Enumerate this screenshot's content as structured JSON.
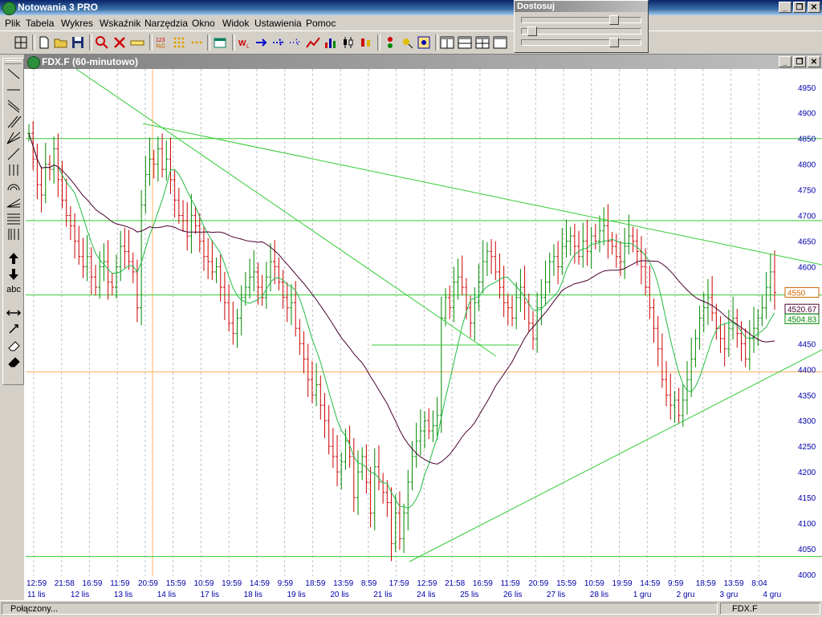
{
  "app": {
    "title": "Notowania 3 PRO"
  },
  "menu": [
    "Plik",
    "Tabela",
    "Wykres",
    "Wskaźnik",
    "Narzędzia",
    "Okno",
    "Widok",
    "Ustawienia",
    "Pomoc"
  ],
  "adjust_panel": {
    "title": "Dostosuj",
    "sliders": [
      0.8,
      0.05,
      0.8
    ]
  },
  "left_tools": {
    "text_tool": "abc"
  },
  "chart_window": {
    "title": "FDX.F (60-minutowo)"
  },
  "status": {
    "connection": "Połączony...",
    "symbol": "FDX.F"
  },
  "colors": {
    "accent_green": "#33cc33",
    "ma_dark": "#4a0030",
    "bar_red": "#cc0000",
    "bar_green": "#008800",
    "axis_text": "#0000aa",
    "grid": "#c0c0c0",
    "orange": "#ffb060"
  },
  "icons": [
    "crosshair-icon",
    "new-file-icon",
    "open-folder-icon",
    "save-icon",
    "zoom-icon",
    "delete-icon",
    "ruler-icon",
    "fib-icon",
    "grid-icon",
    "window-icon",
    "wl-icon",
    "arrows-icon",
    "line-chart-icon",
    "bar-chart-icon",
    "candles-icon",
    "traffic-light-icon",
    "pin-icon",
    "image-icon",
    "layout-icon"
  ],
  "chart_data": {
    "type": "bar",
    "symbol": "FDX.F",
    "interval": "60-minutowo",
    "y_axis": {
      "labels": [
        "4950",
        "4900",
        "4850",
        "4800",
        "4750",
        "4700",
        "4650",
        "4600",
        "4550",
        "4500",
        "4450",
        "4400",
        "4350",
        "4300",
        "4250",
        "4200",
        "4150",
        "4100",
        "4050",
        "4000"
      ],
      "ylim": [
        4000,
        4970
      ]
    },
    "x_time_labels": [
      "12:59",
      "21:58",
      "16:59",
      "11:59",
      "20:59",
      "15:59",
      "10:59",
      "19:59",
      "14:59",
      "9:59",
      "18:59",
      "13:59",
      "8:59",
      "17:59",
      "12:59",
      "21:58",
      "16:59",
      "11:59",
      "20:59",
      "15:59",
      "10:59",
      "19:59",
      "14:59",
      "9:59",
      "18:59",
      "13:59",
      "8:04"
    ],
    "x_date_labels": [
      "11 lis",
      "12 lis",
      "13 lis",
      "14 lis",
      "17 lis",
      "18 lis",
      "19 lis",
      "20 lis",
      "21 lis",
      "24 lis",
      "25 lis",
      "26 lis",
      "27 lis",
      "28 lis",
      "1 gru",
      "2 gru",
      "3 gru",
      "4 gru"
    ],
    "price_markers": [
      {
        "label": "4550",
        "value": 4550,
        "color": "#cc6600"
      },
      {
        "label": "4520.67",
        "value": 4520.67,
        "color": "#4a0030"
      },
      {
        "label": "4504.83",
        "value": 4504.83,
        "color": "#008800"
      }
    ],
    "horizontal_levels": [
      4850,
      4690,
      4545,
      4035
    ],
    "orange_level": 4395,
    "ohlc_closes": [
      4860,
      4810,
      4760,
      4740,
      4800,
      4790,
      4830,
      4770,
      4730,
      4700,
      4680,
      4650,
      4620,
      4600,
      4620,
      4580,
      4560,
      4600,
      4610,
      4570,
      4560,
      4600,
      4640,
      4630,
      4610,
      4590,
      4520,
      4720,
      4780,
      4810,
      4800,
      4830,
      4790,
      4810,
      4770,
      4730,
      4700,
      4690,
      4660,
      4700,
      4680,
      4650,
      4620,
      4610,
      4590,
      4600,
      4560,
      4530,
      4490,
      4470,
      4500,
      4540,
      4560,
      4580,
      4590,
      4560,
      4540,
      4580,
      4610,
      4600,
      4570,
      4540,
      4520,
      4530,
      4480,
      4450,
      4420,
      4380,
      4350,
      4370,
      4330,
      4300,
      4250,
      4230,
      4200,
      4220,
      4260,
      4230,
      4150,
      4200,
      4230,
      4180,
      4120,
      4210,
      4180,
      4160,
      4140,
      4060,
      4120,
      4070,
      4120,
      4180,
      4230,
      4260,
      4280,
      4300,
      4280,
      4290,
      4310,
      4500,
      4540,
      4520,
      4570,
      4580,
      4560,
      4520,
      4490,
      4530,
      4570,
      4610,
      4630,
      4620,
      4590,
      4560,
      4530,
      4520,
      4500,
      4540,
      4560,
      4530,
      4490,
      4460,
      4520,
      4540,
      4570,
      4610,
      4620,
      4600,
      4640,
      4650,
      4660,
      4640,
      4620,
      4650,
      4630,
      4660,
      4650,
      4670,
      4680,
      4650,
      4640,
      4620,
      4610,
      4640,
      4660,
      4650,
      4630,
      4600,
      4560,
      4520,
      4480,
      4440,
      4380,
      4350,
      4330,
      4340,
      4310,
      4340,
      4380,
      4420,
      4460,
      4500,
      4520,
      4540,
      4510,
      4480,
      4460,
      4440,
      4480,
      4500,
      4470,
      4450,
      4420,
      4460,
      4480,
      4500,
      4520,
      4560,
      4590,
      4550
    ]
  }
}
